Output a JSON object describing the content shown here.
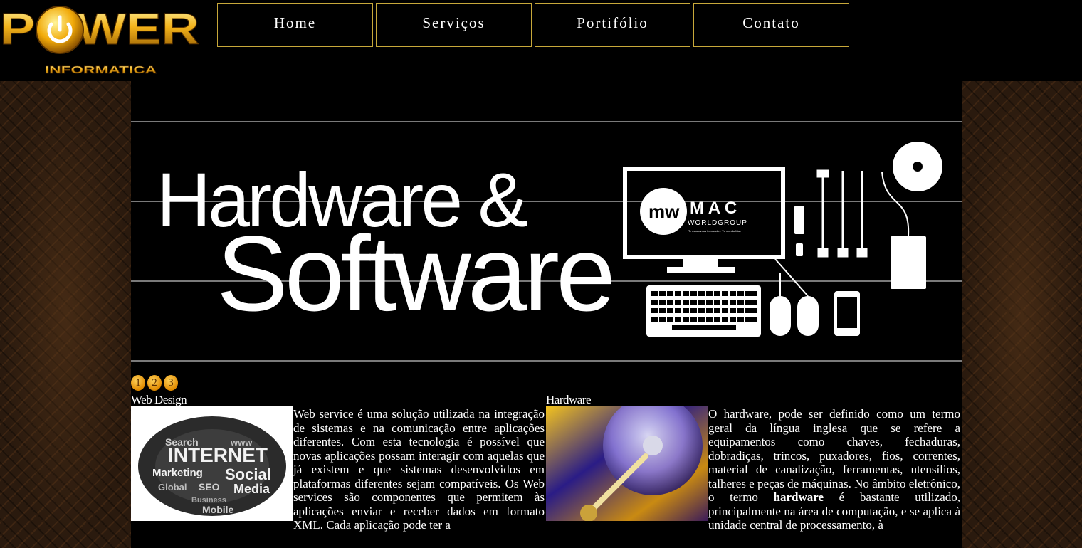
{
  "brand": {
    "logo_text": "POWER",
    "logo_sub": "INFORMATICA"
  },
  "nav": {
    "items": [
      "Home",
      "Serviços",
      "Portifólio",
      "Contato"
    ]
  },
  "banner": {
    "line1": "Hardware &",
    "line2": "Software",
    "mac_brand": "M A C",
    "mac_group": "WORLDGROUP",
    "mac_tagline": "Te mostramos tu mundo... Tu mundo Mac"
  },
  "slider": {
    "pages": [
      "1",
      "2",
      "3"
    ]
  },
  "sections": {
    "web": {
      "title": "Web Design",
      "thumb_words": [
        "INTERNET",
        "Social",
        "Marketing",
        "SEO",
        "Media",
        "Global",
        "Search",
        "Mobile",
        "Business",
        "www"
      ],
      "text": "Web service é uma solução utilizada na integração de sistemas e na comunicação entre aplicações diferentes. Com esta tecnologia é possível que novas aplicações possam interagir com aquelas que já existem e que sistemas desenvolvidos em plataformas diferentes sejam compatíveis. Os Web services são componentes que permitem às aplicações enviar e receber dados em formato XML. Cada aplicação pode ter a"
    },
    "hardware": {
      "title": "Hardware",
      "text_before": "O hardware, pode ser definido como um termo geral da língua inglesa que se refere a equipamentos como chaves, fechaduras, dobradiças, trincos, puxadores, fios, correntes, material de canalização, ferramentas, utensílios, talheres e peças de máquinas. No âmbito eletrônico, o termo ",
      "text_bold": "hardware",
      "text_after": " é bastante utilizado, principalmente na área de computação, e se aplica à unidade central de processamento, à"
    }
  },
  "colors": {
    "accent_gold": "#c7a83a",
    "dot_orange": "#f0a000"
  }
}
